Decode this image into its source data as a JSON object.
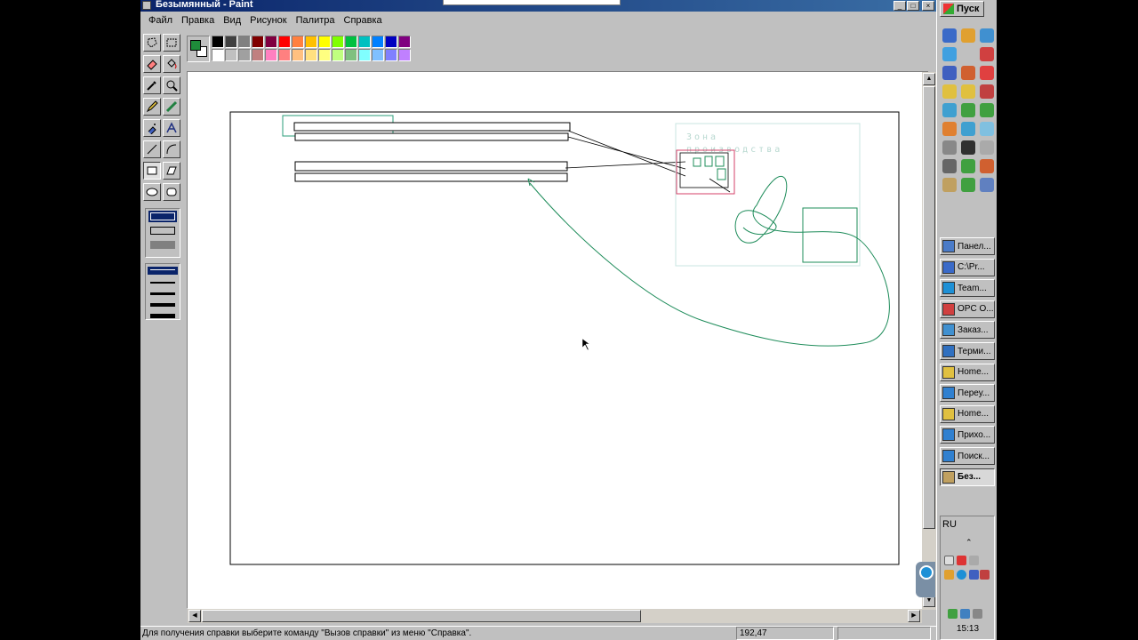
{
  "window": {
    "title": "Безымянный - Paint"
  },
  "menu": [
    "Файл",
    "Правка",
    "Вид",
    "Рисунок",
    "Палитра",
    "Справка"
  ],
  "tools": [
    {
      "name": "free-select-icon"
    },
    {
      "name": "rect-select-icon"
    },
    {
      "name": "eraser-icon"
    },
    {
      "name": "fill-bucket-icon"
    },
    {
      "name": "color-picker-icon"
    },
    {
      "name": "magnifier-icon"
    },
    {
      "name": "pencil-icon"
    },
    {
      "name": "brush-icon"
    },
    {
      "name": "airbrush-icon"
    },
    {
      "name": "text-icon"
    },
    {
      "name": "line-icon"
    },
    {
      "name": "curve-icon"
    },
    {
      "name": "rectangle-icon"
    },
    {
      "name": "polygon-icon"
    },
    {
      "name": "ellipse-icon"
    },
    {
      "name": "rounded-rect-icon"
    }
  ],
  "palette": {
    "foreground": "#1e8c3a",
    "background": "#ffffff",
    "row1": [
      "#000000",
      "#404040",
      "#808080",
      "#800000",
      "#800040",
      "#ff0000",
      "#ff8040",
      "#ffc000",
      "#ffff00",
      "#80ff00",
      "#00c040",
      "#00c0c0",
      "#0080ff",
      "#0000c0",
      "#800080"
    ],
    "row2": [
      "#ffffff",
      "#c0c0c0",
      "#a0a0a0",
      "#c08080",
      "#ff80c0",
      "#ff8080",
      "#ffc080",
      "#ffe080",
      "#ffff80",
      "#c0ff80",
      "#80c080",
      "#80ffff",
      "#80c0ff",
      "#8080ff",
      "#c080ff"
    ]
  },
  "drawing": {
    "label_line1": "Зона",
    "label_line2": "производства",
    "line_color": "#1e8c5a",
    "frame_color": "#c8e6e0",
    "highlight_color": "#d4406a"
  },
  "status": {
    "help_text": "Для получения справки выберите команду \"Вызов справки\" из меню \"Справка\".",
    "coordinates": "192,47"
  },
  "taskbar": {
    "start_label": "Пуск",
    "buttons": [
      {
        "label": "Панел...",
        "color": "#4a7bc8"
      },
      {
        "label": "C:\\Pr...",
        "color": "#3a6ac8"
      },
      {
        "label": "Team...",
        "color": "#1e90d6"
      },
      {
        "label": "OPC O...",
        "color": "#d04040"
      },
      {
        "label": "Заказ...",
        "color": "#4090d0"
      },
      {
        "label": "Терми...",
        "color": "#3070c0"
      },
      {
        "label": "Home...",
        "color": "#e0c040"
      },
      {
        "label": "Переу...",
        "color": "#3080d0"
      },
      {
        "label": "Home...",
        "color": "#e0c040"
      },
      {
        "label": "Прихо...",
        "color": "#3080d0"
      },
      {
        "label": "Поиск...",
        "color": "#3080d0"
      },
      {
        "label": "Без...",
        "color": "#c0a060"
      }
    ],
    "language": "RU",
    "clock": "15:13"
  }
}
